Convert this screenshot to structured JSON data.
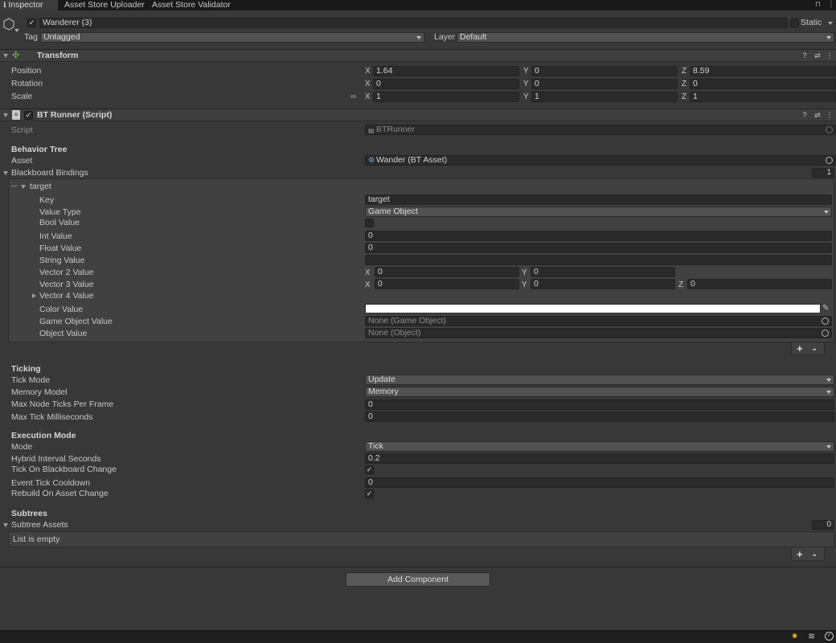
{
  "tabs": [
    {
      "label": "Inspector",
      "active": true
    },
    {
      "label": "Asset Store Uploader",
      "active": false
    },
    {
      "label": "Asset Store Validator",
      "active": false
    }
  ],
  "gameobject": {
    "name": "Wanderer (3)",
    "static_label": "Static",
    "tag_label": "Tag",
    "tag_value": "Untagged",
    "layer_label": "Layer",
    "layer_value": "Default"
  },
  "transform": {
    "title": "Transform",
    "position_label": "Position",
    "rotation_label": "Rotation",
    "scale_label": "Scale",
    "position": {
      "x": "1.64",
      "y": "0",
      "z": "8.59"
    },
    "rotation": {
      "x": "0",
      "y": "0",
      "z": "0"
    },
    "scale": {
      "x": "1",
      "y": "1",
      "z": "1"
    }
  },
  "axes": {
    "x": "X",
    "y": "Y",
    "z": "Z"
  },
  "bt_runner": {
    "title": "BT Runner (Script)",
    "script_label": "Script",
    "script_value": "BTRunner",
    "behavior_tree_header": "Behavior Tree",
    "asset_label": "Asset",
    "asset_value": "Wander (BT Asset)",
    "blackboard_label": "Blackboard Bindings",
    "blackboard_count": "1",
    "element_name": "target",
    "key_label": "Key",
    "key_value": "target",
    "value_type_label": "Value Type",
    "value_type_value": "Game Object",
    "bool_label": "Bool Value",
    "int_label": "Int Value",
    "int_value": "0",
    "float_label": "Float Value",
    "float_value": "0",
    "string_label": "String Value",
    "vec2_label": "Vector 2 Value",
    "vec2": {
      "x": "0",
      "y": "0"
    },
    "vec3_label": "Vector 3 Value",
    "vec3": {
      "x": "0",
      "y": "0",
      "z": "0"
    },
    "vec4_label": "Vector 4 Value",
    "color_label": "Color Value",
    "color_value": "#ffffff",
    "gameobject_value_label": "Game Object Value",
    "gameobject_value": "None (Game Object)",
    "object_value_label": "Object Value",
    "object_value": "None (Object)",
    "ticking_header": "Ticking",
    "tick_mode_label": "Tick Mode",
    "tick_mode_value": "Update",
    "memory_model_label": "Memory Model",
    "memory_model_value": "Memory",
    "max_node_ticks_label": "Max Node Ticks Per Frame",
    "max_node_ticks_value": "0",
    "max_tick_ms_label": "Max Tick Milliseconds",
    "max_tick_ms_value": "0",
    "execution_header": "Execution Mode",
    "mode_label": "Mode",
    "mode_value": "Tick",
    "hybrid_label": "Hybrid Interval Seconds",
    "hybrid_value": "0.2",
    "tick_on_bb_label": "Tick On Blackboard Change",
    "event_cooldown_label": "Event Tick Cooldown",
    "event_cooldown_value": "0",
    "rebuild_label": "Rebuild On Asset Change",
    "subtrees_header": "Subtrees",
    "subtree_assets_label": "Subtree Assets",
    "subtree_count": "0",
    "list_empty": "List is empty"
  },
  "add_component_label": "Add Component",
  "plus_label": "+",
  "minus_label": "-",
  "checkmark": "✓"
}
